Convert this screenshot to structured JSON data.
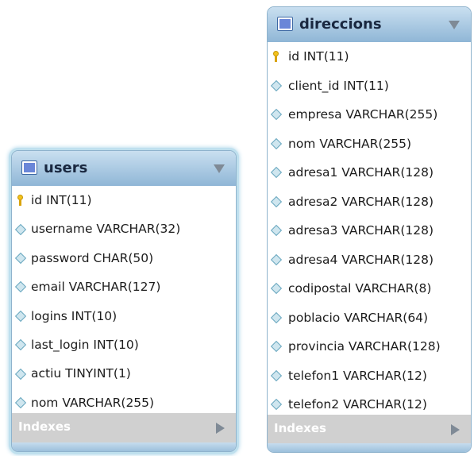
{
  "tables": [
    {
      "name": "users",
      "columns": [
        {
          "label": "id INT(11)",
          "key": true
        },
        {
          "label": "username VARCHAR(32)",
          "key": false
        },
        {
          "label": "password CHAR(50)",
          "key": false
        },
        {
          "label": "email VARCHAR(127)",
          "key": false
        },
        {
          "label": "logins INT(10)",
          "key": false
        },
        {
          "label": "last_login INT(10)",
          "key": false
        },
        {
          "label": "actiu TINYINT(1)",
          "key": false
        },
        {
          "label": "nom VARCHAR(255)",
          "key": false
        }
      ],
      "footer": "Indexes",
      "selected": true
    },
    {
      "name": "direccions",
      "columns": [
        {
          "label": "id INT(11)",
          "key": true
        },
        {
          "label": "client_id INT(11)",
          "key": false
        },
        {
          "label": "empresa VARCHAR(255)",
          "key": false
        },
        {
          "label": "nom VARCHAR(255)",
          "key": false
        },
        {
          "label": "adresa1 VARCHAR(128)",
          "key": false
        },
        {
          "label": "adresa2 VARCHAR(128)",
          "key": false
        },
        {
          "label": "adresa3 VARCHAR(128)",
          "key": false
        },
        {
          "label": "adresa4 VARCHAR(128)",
          "key": false
        },
        {
          "label": "codipostal VARCHAR(8)",
          "key": false
        },
        {
          "label": "poblacio VARCHAR(64)",
          "key": false
        },
        {
          "label": "provincia VARCHAR(128)",
          "key": false
        },
        {
          "label": "telefon1 VARCHAR(12)",
          "key": false
        },
        {
          "label": "telefon2 VARCHAR(12)",
          "key": false
        }
      ],
      "footer": "Indexes",
      "selected": false
    }
  ],
  "icons": {
    "table": "table-icon",
    "primary_key": "key-icon",
    "column": "column-diamond-icon",
    "collapse": "collapse-triangle-icon",
    "expand": "expand-triangle-icon"
  },
  "colors": {
    "header_gradient_top": "#c9dff0",
    "header_gradient_bottom": "#8fb6d6",
    "footer_bg": "#d0d0d0",
    "selection_glow": "#a8d3e8",
    "key_gold": "#f2c21d"
  }
}
